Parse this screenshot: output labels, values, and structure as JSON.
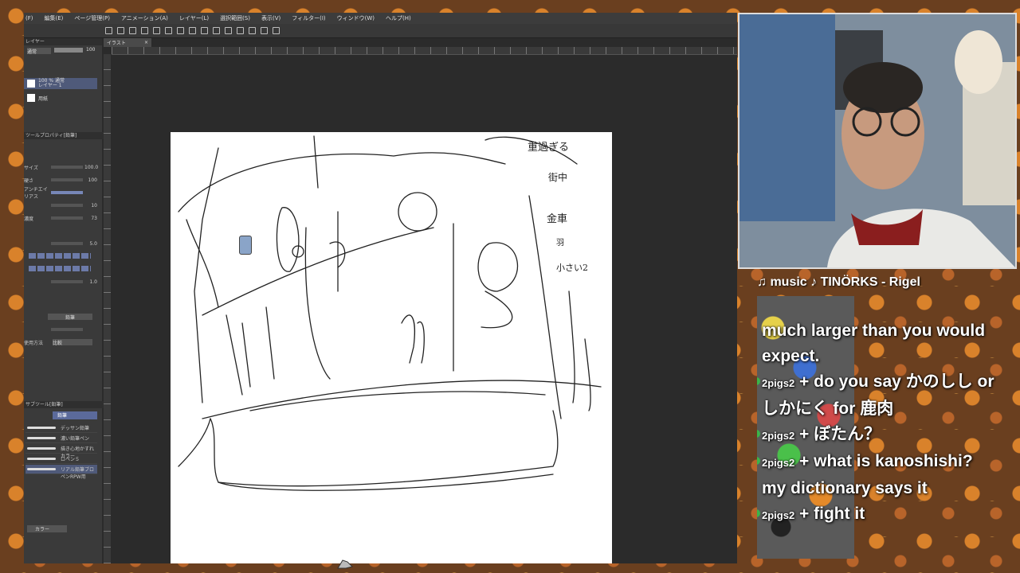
{
  "app": {
    "menu": [
      "(F)",
      "編集(E)",
      "ページ管理(P)",
      "アニメーション(A)",
      "レイヤー(L)",
      "選択範囲(S)",
      "表示(V)",
      "フィルター(I)",
      "ウィンドウ(W)",
      "ヘルプ(H)"
    ],
    "doc_tab": "イラスト",
    "layers_panel": {
      "header": "レイヤー",
      "blend": "通常",
      "opacity": "100",
      "layer1_line1": "100 % 通常",
      "layer1_line2": "レイヤー 1",
      "layer2": "用紙"
    },
    "tool_property": {
      "header": "ツールプロパティ[鉛筆]",
      "rows": [
        {
          "label": "サイズ",
          "value": "100.0"
        },
        {
          "label": "硬さ",
          "value": "100"
        },
        {
          "label": "アンチエイリアス",
          "value": ""
        },
        {
          "label": "",
          "value": "10"
        },
        {
          "label": "濃度",
          "value": "73"
        },
        {
          "label": "",
          "value": "5.0"
        },
        {
          "label": "",
          "value": "1.0"
        },
        {
          "label": "",
          "value": "1"
        }
      ],
      "pencil_label": "鉛筆",
      "method_label": "使用方法",
      "method_value": "比較"
    },
    "brush_panel": {
      "header": "サブツール[鉛筆]",
      "tab": "鉛筆",
      "items": [
        "デッサン鉛筆",
        "濃い鉛筆ペン",
        "描き心地かすれ カラー",
        "ロペン５",
        "リアル鉛筆ブロペンRPW用"
      ]
    },
    "color_panel": {
      "label": "カラー"
    }
  },
  "canvas": {
    "notes": [
      "重過ぎる",
      "街中",
      "金車",
      "羽",
      "小さい2"
    ]
  },
  "overlay": {
    "music": "♫ music ♪ TINÖRKS - Rigel"
  },
  "chat": {
    "messages": [
      {
        "user": "",
        "text": "much larger than you would expect."
      },
      {
        "user": "2pigs2",
        "text": "do you say かのしし or しかにく for 鹿肉"
      },
      {
        "user": "2pigs2",
        "text": "ぼたん？"
      },
      {
        "user": "2pigs2",
        "text": "what is kanoshishi? my dictionary says it"
      },
      {
        "user": "2pigs2",
        "text": "fight it"
      }
    ]
  },
  "colors": {
    "accent_green": "#3ab54a",
    "panel_bg": "#3a3a3a",
    "canvas_bg": "#ffffff"
  }
}
